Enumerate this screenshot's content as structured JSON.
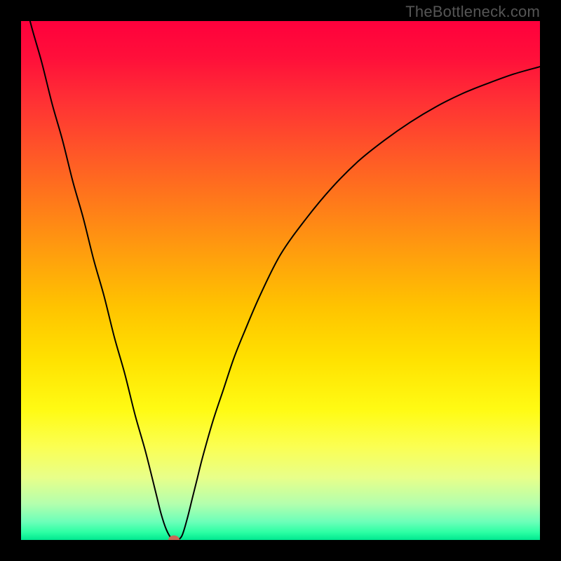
{
  "watermark": "TheBottleneck.com",
  "chart_data": {
    "type": "line",
    "title": "",
    "xlabel": "",
    "ylabel": "",
    "xlim": [
      0,
      100
    ],
    "ylim": [
      0,
      100
    ],
    "series": [
      {
        "name": "curve",
        "x": [
          0,
          2,
          4,
          6,
          8,
          10,
          12,
          14,
          16,
          18,
          20,
          22,
          24,
          26,
          27,
          28,
          29,
          30,
          31,
          32,
          33,
          34,
          35,
          37,
          39,
          41,
          43,
          46,
          50,
          55,
          60,
          65,
          70,
          75,
          80,
          85,
          90,
          95,
          100
        ],
        "y": [
          107,
          99,
          92,
          84,
          77,
          69,
          62,
          54,
          47,
          39,
          32,
          24,
          17,
          9,
          5,
          2,
          0.3,
          0,
          0.8,
          4,
          8,
          12,
          16,
          23,
          29,
          35,
          40,
          47,
          55,
          62,
          68,
          73,
          77,
          80.5,
          83.5,
          86,
          88,
          89.8,
          91.2
        ]
      }
    ],
    "marker": {
      "x": 29.4,
      "y": 0,
      "color": "#c96a56"
    },
    "gradient_stops": [
      {
        "offset": 0,
        "color": "#ff003c"
      },
      {
        "offset": 0.07,
        "color": "#ff0f3a"
      },
      {
        "offset": 0.15,
        "color": "#ff2f35"
      },
      {
        "offset": 0.25,
        "color": "#ff5528"
      },
      {
        "offset": 0.35,
        "color": "#ff7a1a"
      },
      {
        "offset": 0.45,
        "color": "#ff9f0d"
      },
      {
        "offset": 0.55,
        "color": "#ffc300"
      },
      {
        "offset": 0.65,
        "color": "#ffe100"
      },
      {
        "offset": 0.75,
        "color": "#fffb14"
      },
      {
        "offset": 0.82,
        "color": "#fbff52"
      },
      {
        "offset": 0.88,
        "color": "#e8ff8a"
      },
      {
        "offset": 0.93,
        "color": "#b4ffad"
      },
      {
        "offset": 0.965,
        "color": "#6cffb9"
      },
      {
        "offset": 0.985,
        "color": "#2dffa4"
      },
      {
        "offset": 1.0,
        "color": "#00e88f"
      }
    ],
    "curve_color": "#000000",
    "curve_width": 2
  }
}
